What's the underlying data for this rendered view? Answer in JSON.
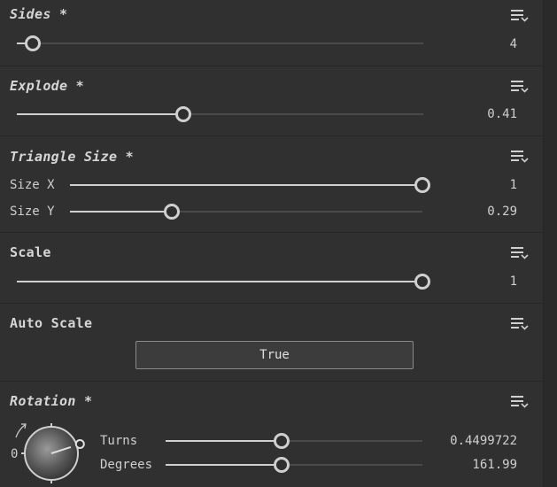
{
  "sections": {
    "sides": {
      "title": "Sides *",
      "value": "4",
      "fraction": 0.04
    },
    "explode": {
      "title": "Explode *",
      "value": "0.41",
      "fraction": 0.41
    },
    "triangle_size": {
      "title": "Triangle Size *",
      "size_x": {
        "label": "Size X",
        "value": "1",
        "fraction": 1.0
      },
      "size_y": {
        "label": "Size Y",
        "value": "0.29",
        "fraction": 0.29
      }
    },
    "scale": {
      "title": "Scale",
      "value": "1",
      "fraction": 1.0
    },
    "auto_scale": {
      "title": "Auto Scale",
      "button_label": "True"
    },
    "rotation": {
      "title": "Rotation *",
      "dial_zero_label": "0",
      "turns": {
        "label": "Turns",
        "value": "0.4499722",
        "fraction": 0.45
      },
      "degrees": {
        "label": "Degrees",
        "value": "161.99",
        "fraction": 0.45
      }
    }
  },
  "icons": {
    "menu": "list-menu-dropdown-icon",
    "rotation_hint": "curved-arrow-icon"
  },
  "colors": {
    "background": "#303030",
    "accent": "#cfcfcf",
    "track": "#4a4a4a"
  }
}
